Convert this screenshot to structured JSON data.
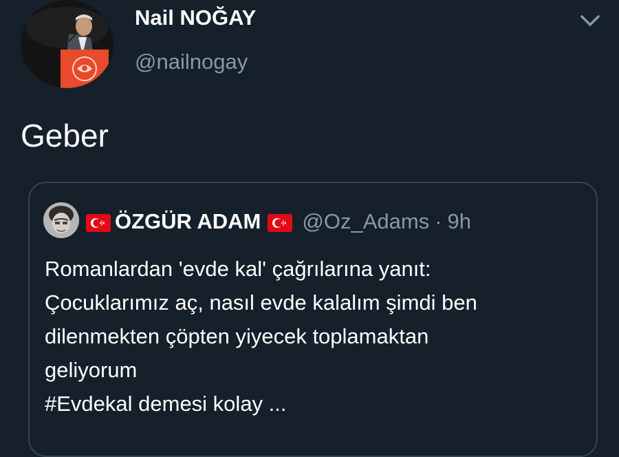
{
  "tweet": {
    "author": {
      "name": "Nail NOĞAY",
      "handle": "@nailnogay",
      "avatar_icon": "profile-photo"
    },
    "text": "Geber",
    "menu_icon": "chevron-down-icon"
  },
  "quoted_tweet": {
    "author": {
      "name": "ÖZGÜR ADAM",
      "handle": "@Oz_Adams",
      "flag_icon": "turkish-flag-icon",
      "avatar_icon": "profile-photo"
    },
    "separator": "·",
    "time": "9h",
    "lines": [
      "Romanlardan 'evde kal' çağrılarına yanıt:",
      "Çocuklarımız aç, nasıl evde kalalım şimdi ben",
      "dilenmekten çöpten yiyecek toplamaktan",
      "geliyorum",
      "#Evdekal demesi kolay ..."
    ]
  },
  "colors": {
    "background": "#15202b",
    "primary_text": "#ffffff",
    "secondary_text": "#8899a6",
    "card_border": "#38444d",
    "flag_red": "#e30a17"
  }
}
